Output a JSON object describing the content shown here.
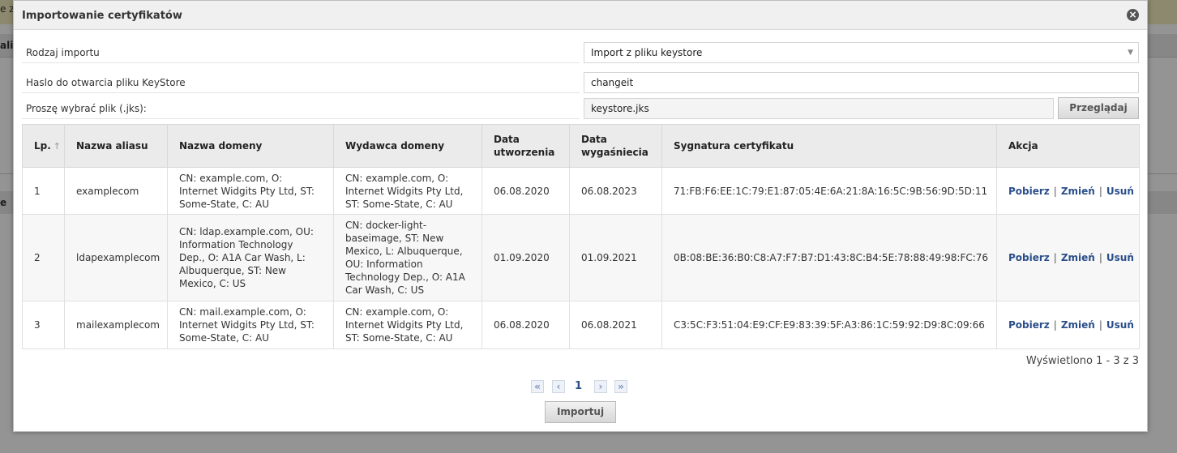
{
  "background": {
    "top_fragment": "e z",
    "bar_fragment": "ali",
    "bar2_fragment": "e"
  },
  "dialog": {
    "title": "Importowanie certyfikatów",
    "close_icon": "close-icon"
  },
  "form": {
    "import_type_label": "Rodzaj importu",
    "import_type_value": "Import z pliku keystore",
    "password_label": "Haslo do otwarcia pliku KeyStore",
    "password_value": "changeit",
    "file_label": "Proszę wybrać plik (.jks):",
    "file_value": "keystore.jks",
    "browse_label": "Przeglądaj"
  },
  "table": {
    "columns": [
      "Lp.",
      "Nazwa aliasu",
      "Nazwa domeny",
      "Wydawca domeny",
      "Data utworzenia",
      "Data wygaśniecia",
      "Sygnatura certyfikatu",
      "Akcja"
    ],
    "rows": [
      {
        "lp": "1",
        "alias": "examplecom",
        "domain": "CN: example.com, O: Internet Widgits Pty Ltd, ST: Some-State, C: AU",
        "issuer": "CN: example.com, O: Internet Widgits Pty Ltd, ST: Some-State, C: AU",
        "created": "06.08.2020",
        "expires": "06.08.2023",
        "signature": "71:FB:F6:EE:1C:79:E1:87:05:4E:6A:21:8A:16:5C:9B:56:9D:5D:11"
      },
      {
        "lp": "2",
        "alias": "ldapexamplecom",
        "domain": "CN: ldap.example.com, OU: Information Technology Dep., O: A1A Car Wash, L: Albuquerque, ST: New Mexico, C: US",
        "issuer": "CN: docker-light-baseimage, ST: New Mexico, L: Albuquerque, OU: Information Technology Dep., O: A1A Car Wash, C: US",
        "created": "01.09.2020",
        "expires": "01.09.2021",
        "signature": "0B:08:BE:36:B0:C8:A7:F7:B7:D1:43:8C:B4:5E:78:88:49:98:FC:76"
      },
      {
        "lp": "3",
        "alias": "mailexamplecom",
        "domain": "CN: mail.example.com, O: Internet Widgits Pty Ltd, ST: Some-State, C: AU",
        "issuer": "CN: example.com, O: Internet Widgits Pty Ltd, ST: Some-State, C: AU",
        "created": "06.08.2020",
        "expires": "06.08.2021",
        "signature": "C3:5C:F3:51:04:E9:CF:E9:83:39:5F:A3:86:1C:59:92:D9:8C:09:66"
      }
    ],
    "actions": {
      "download": "Pobierz",
      "change": "Zmień",
      "remove": "Usuń",
      "separator": "|"
    }
  },
  "summary": "Wyświetlono 1 - 3 z 3",
  "pager": {
    "first": "«",
    "prev": "‹",
    "page": "1",
    "next": "›",
    "last": "»"
  },
  "import_button": "Importuj",
  "colors": {
    "link": "#2a4e8a",
    "header_bg": "#ebebeb"
  }
}
